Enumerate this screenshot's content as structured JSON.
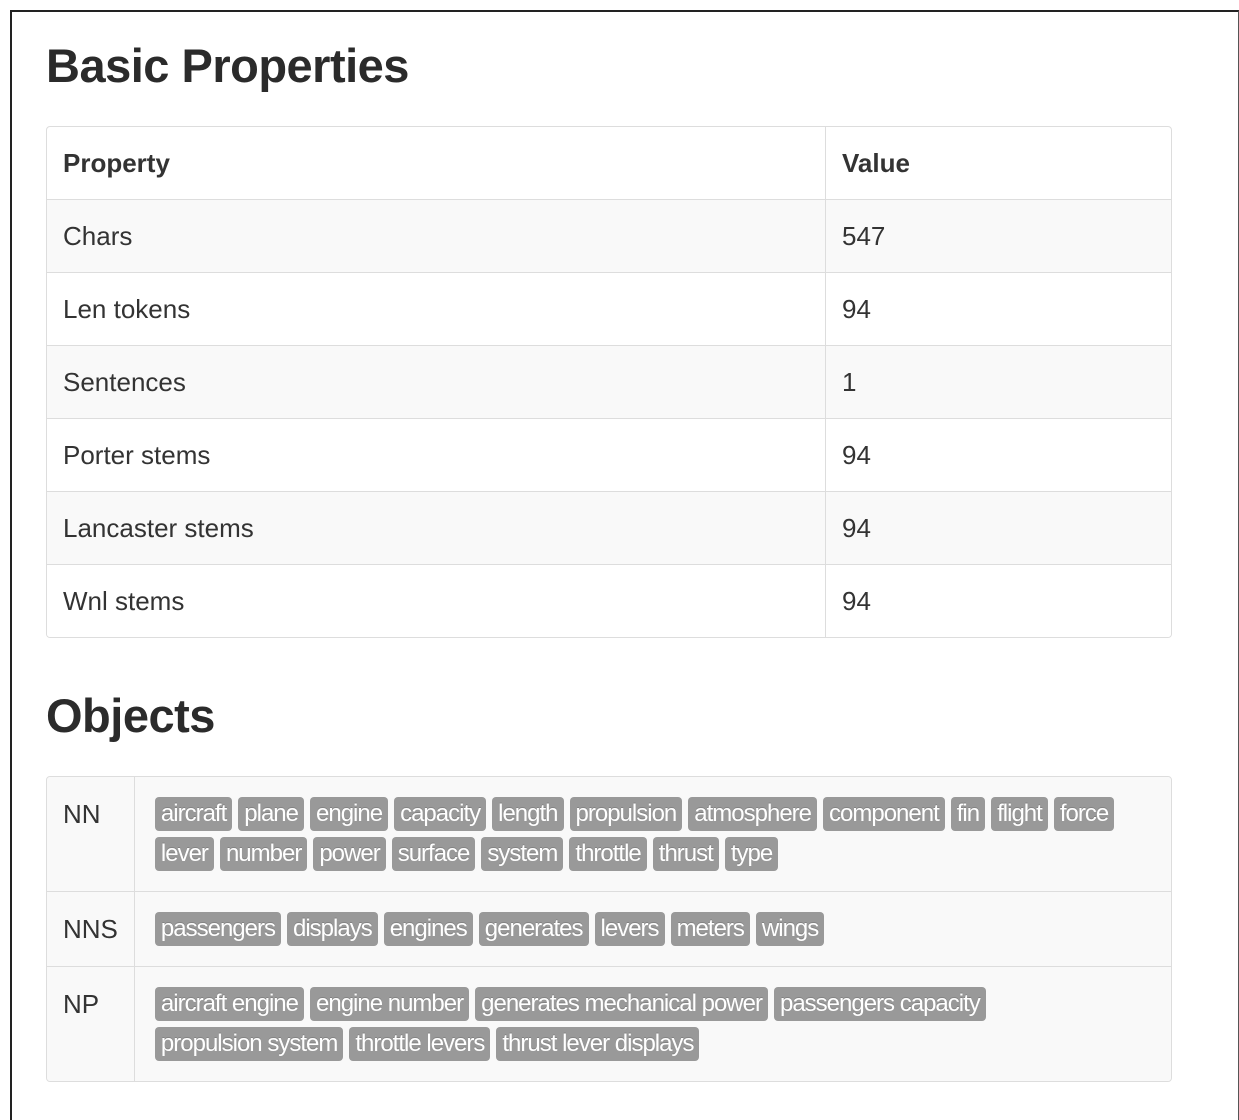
{
  "basic": {
    "title": "Basic Properties",
    "headers": {
      "property": "Property",
      "value": "Value"
    },
    "rows": [
      {
        "property": "Chars",
        "value": "547"
      },
      {
        "property": "Len tokens",
        "value": "94"
      },
      {
        "property": "Sentences",
        "value": "1"
      },
      {
        "property": "Porter stems",
        "value": "94"
      },
      {
        "property": "Lancaster stems",
        "value": "94"
      },
      {
        "property": "Wnl stems",
        "value": "94"
      }
    ]
  },
  "objects": {
    "title": "Objects",
    "groups": [
      {
        "tag": "NN",
        "items": [
          "aircraft",
          "plane",
          "engine",
          "capacity",
          "length",
          "propulsion",
          "atmosphere",
          "component",
          "fin",
          "flight",
          "force",
          "lever",
          "number",
          "power",
          "surface",
          "system",
          "throttle",
          "thrust",
          "type"
        ]
      },
      {
        "tag": "NNS",
        "items": [
          "passengers",
          "displays",
          "engines",
          "generates",
          "levers",
          "meters",
          "wings"
        ]
      },
      {
        "tag": "NP",
        "items": [
          "aircraft engine",
          "engine number",
          "generates mechanical power",
          "passengers capacity",
          "propulsion system",
          "throttle levers",
          "thrust lever displays"
        ]
      }
    ]
  },
  "colors": {
    "label_bg": "#999999",
    "stripe_bg": "#f9f9f9",
    "border": "#dddddd"
  }
}
